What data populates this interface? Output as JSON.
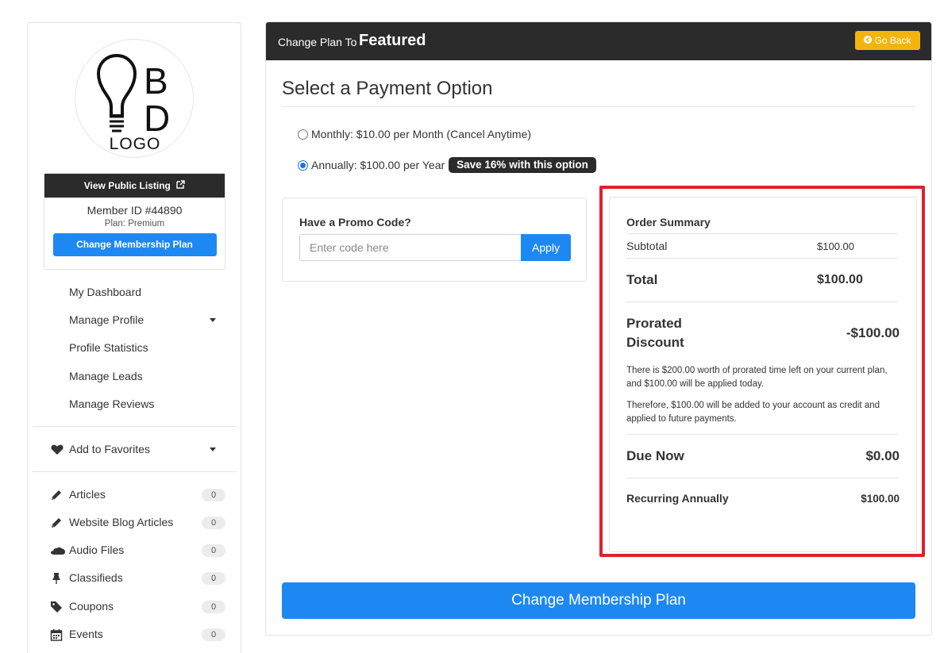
{
  "sidebar": {
    "logo": {
      "letter_top": "B",
      "letter_bottom": "D",
      "word": "LOGO"
    },
    "member_card": {
      "view_listing_label": "View Public Listing",
      "member_id": "Member ID #44890",
      "plan": "Plan: Premium",
      "change_plan_label": "Change Membership Plan"
    },
    "nav": [
      {
        "label": "My Dashboard"
      },
      {
        "label": "Manage Profile"
      },
      {
        "label": "Profile Statistics"
      },
      {
        "label": "Manage Leads"
      },
      {
        "label": "Manage Reviews"
      }
    ],
    "favorites_label": "Add to Favorites",
    "features": [
      {
        "label": "Articles",
        "count": "0",
        "icon": "pencil-icon"
      },
      {
        "label": "Website Blog Articles",
        "count": "0",
        "icon": "pencil-icon"
      },
      {
        "label": "Audio Files",
        "count": "0",
        "icon": "soundcloud-icon"
      },
      {
        "label": "Classifieds",
        "count": "0",
        "icon": "pushpin-icon"
      },
      {
        "label": "Coupons",
        "count": "0",
        "icon": "tag-icon"
      },
      {
        "label": "Events",
        "count": "0",
        "icon": "calendar-icon"
      }
    ]
  },
  "header": {
    "prefix": "Change Plan To",
    "plan_name": "Featured",
    "go_back_label": "Go Back"
  },
  "payment": {
    "title": "Select a Payment Option",
    "monthly_label": "Monthly: $10.00 per Month (Cancel Anytime)",
    "annual_label": "Annually: $100.00 per Year",
    "annual_badge": "Save 16% with this option",
    "selected": "annual"
  },
  "promo": {
    "label": "Have a Promo Code?",
    "placeholder": "Enter code here",
    "apply_label": "Apply"
  },
  "summary": {
    "title": "Order Summary",
    "subtotal_label": "Subtotal",
    "subtotal_value": "$100.00",
    "total_label": "Total",
    "total_value": "$100.00",
    "prorated_label_1": "Prorated",
    "prorated_label_2": "Discount",
    "prorated_value": "-$100.00",
    "note_1": "There is $200.00 worth of prorated time left on your current plan, and $100.00 will be applied today.",
    "note_2": "Therefore, $100.00 will be added to your account as credit and applied to future payments.",
    "due_label": "Due Now",
    "due_value": "$0.00",
    "recurring_label": "Recurring Annually",
    "recurring_value": "$100.00"
  },
  "cta_label": "Change Membership Plan",
  "colors": {
    "primary": "#1e88f2",
    "dark": "#2b2b2b",
    "warning": "#f3b40e",
    "highlight": "#e0212e"
  }
}
